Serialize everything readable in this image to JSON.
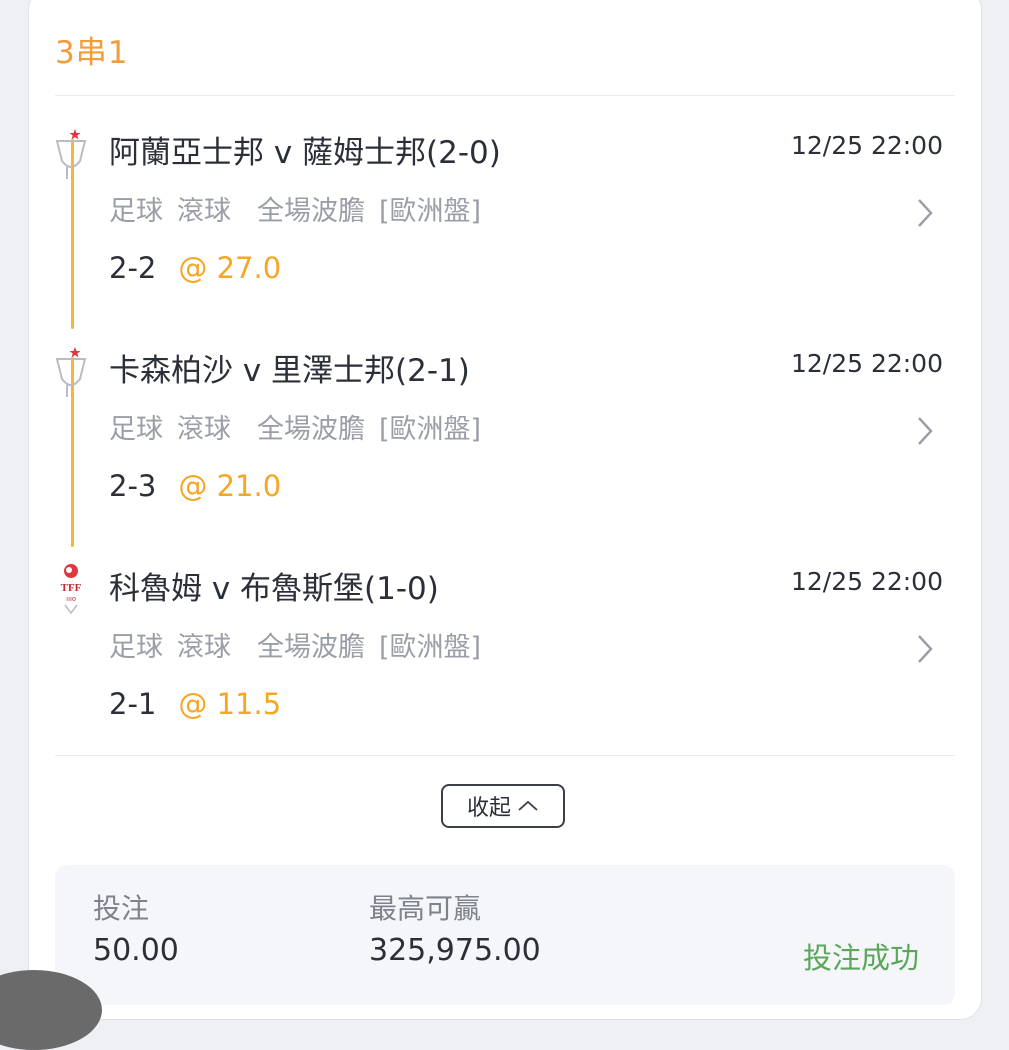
{
  "bet": {
    "type_label": "3串1",
    "legs": [
      {
        "match": "阿蘭亞士邦 v 薩姆士邦(2-0)",
        "time": "12/25 22:00",
        "sport": "足球",
        "phase": "滾球",
        "market": "全場波膽",
        "odds_format": "[歐洲盤]",
        "pick": "2-2",
        "odds": "@ 27.0",
        "icon": "trophy-icon"
      },
      {
        "match": "卡森柏沙 v 里澤士邦(2-1)",
        "time": "12/25 22:00",
        "sport": "足球",
        "phase": "滾球",
        "market": "全場波膽",
        "odds_format": "[歐洲盤]",
        "pick": "2-3",
        "odds": "@ 21.0",
        "icon": "trophy-icon"
      },
      {
        "match": "科魯姆 v 布魯斯堡(1-0)",
        "time": "12/25 22:00",
        "sport": "足球",
        "phase": "滾球",
        "market": "全場波膽",
        "odds_format": "[歐洲盤]",
        "pick": "2-1",
        "odds": "@ 11.5",
        "icon": "tff-league-icon"
      }
    ],
    "collapse_label": "收起",
    "summary": {
      "stake_label": "投注",
      "stake_value": "50.00",
      "max_win_label": "最高可贏",
      "max_win_value": "325,975.00",
      "status": "投注成功"
    }
  },
  "colors": {
    "accent": "#f39c3a",
    "odds": "#f5a623",
    "success": "#5aa65a",
    "timeline": "#f5b640"
  }
}
